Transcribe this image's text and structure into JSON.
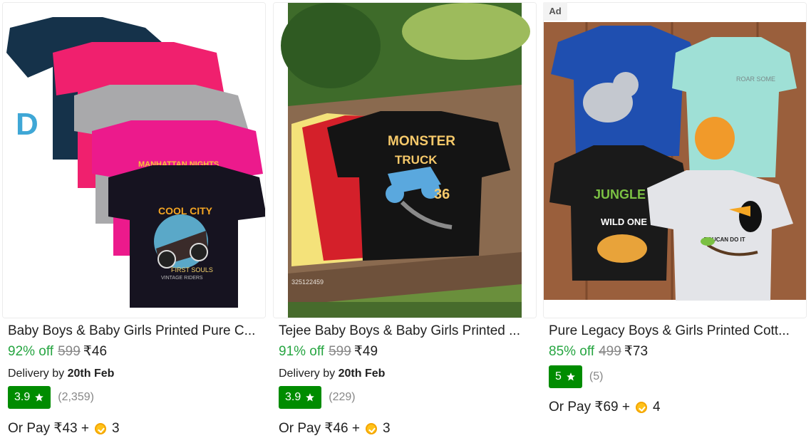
{
  "products": [
    {
      "title": "Baby Boys & Baby Girls Printed Pure C...",
      "discount": "92% off",
      "mrp": "599",
      "price": "₹46",
      "delivery_prefix": "Delivery by",
      "delivery_date": "20th Feb",
      "rating": "3.9",
      "rating_count": "(2,359)",
      "pay_text": "Or Pay ₹43 +",
      "coins": "3",
      "image_texts": [
        "COOL CITY",
        "FIRST SOULS",
        "VINTAGE RIDERS",
        "MANHATTAN NIGHTS",
        "D"
      ]
    },
    {
      "title": "Tejee Baby Boys & Baby Girls Printed ...",
      "discount": "91% off",
      "mrp": "599",
      "price": "₹49",
      "delivery_prefix": "Delivery by",
      "delivery_date": "20th Feb",
      "rating": "3.9",
      "rating_count": "(229)",
      "pay_text": "Or Pay ₹46 +",
      "coins": "3",
      "image_texts": [
        "MONSTER",
        "TRUCK",
        "36",
        "325122459"
      ]
    },
    {
      "ad_label": "Ad",
      "title": "Pure Legacy Boys & Girls Printed Cott...",
      "discount": "85% off",
      "mrp": "499",
      "price": "₹73",
      "rating": "5",
      "rating_count": "(5)",
      "pay_text": "Or Pay ₹69 +",
      "coins": "4",
      "image_texts": [
        "ROAR SOME",
        "JUNGLE",
        "WILD ONE",
        "TOUCAN DO IT"
      ]
    }
  ],
  "colors": {
    "discount": "#26a541",
    "rating_badge": "#008c00",
    "muted": "#878787",
    "text": "#212121"
  },
  "icons": {
    "rating": "star-icon",
    "coin": "supercoin-icon"
  }
}
